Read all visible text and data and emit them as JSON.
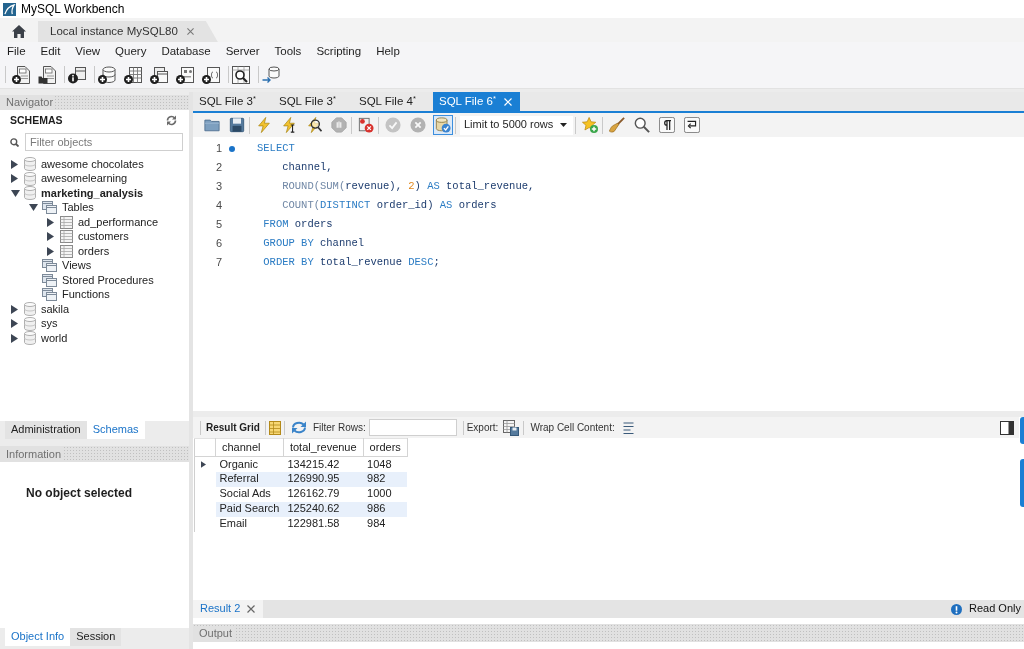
{
  "window": {
    "title": "MySQL Workbench"
  },
  "connection_tab": {
    "label": "Local instance MySQL80"
  },
  "menu": [
    "File",
    "Edit",
    "View",
    "Query",
    "Database",
    "Server",
    "Tools",
    "Scripting",
    "Help"
  ],
  "navigator": {
    "title": "Navigator",
    "section": "SCHEMAS",
    "filter": {
      "placeholder": "Filter objects"
    },
    "tree": [
      {
        "label": "awesome chocolates",
        "kind": "schema",
        "expanded": false,
        "active": false
      },
      {
        "label": "awesomelearning",
        "kind": "schema",
        "expanded": false,
        "active": false
      },
      {
        "label": "marketing_analysis",
        "kind": "schema",
        "expanded": true,
        "active": true,
        "children": [
          {
            "label": "Tables",
            "kind": "folder",
            "expanded": true,
            "children": [
              {
                "label": "ad_performance",
                "kind": "table",
                "expanded": false
              },
              {
                "label": "customers",
                "kind": "table",
                "expanded": false
              },
              {
                "label": "orders",
                "kind": "table",
                "expanded": false
              }
            ]
          },
          {
            "label": "Views",
            "kind": "folder"
          },
          {
            "label": "Stored Procedures",
            "kind": "folder"
          },
          {
            "label": "Functions",
            "kind": "folder"
          }
        ]
      },
      {
        "label": "sakila",
        "kind": "schema",
        "expanded": false,
        "active": false
      },
      {
        "label": "sys",
        "kind": "schema",
        "expanded": false,
        "active": false
      },
      {
        "label": "world",
        "kind": "schema",
        "expanded": false,
        "active": false
      }
    ],
    "tabs": [
      {
        "label": "Administration",
        "selected": false
      },
      {
        "label": "Schemas",
        "selected": true
      }
    ]
  },
  "information": {
    "title": "Information",
    "message": "No object selected",
    "tabs": [
      {
        "label": "Object Info",
        "selected": true
      },
      {
        "label": "Session",
        "selected": false
      }
    ]
  },
  "query_tabs": [
    {
      "label": "SQL File 3$^{*}$",
      "selected": false
    },
    {
      "label": "SQL File 3$^{*}$",
      "selected": false
    },
    {
      "label": "SQL File 4$^{*}$",
      "selected": false
    },
    {
      "label": "SQL File 6$^{*}$",
      "selected": true
    }
  ],
  "query_toolbar": {
    "buttons": [
      {
        "disabled": false,
        "on": false
      },
      {
        "disabled": false,
        "on": false
      },
      {
        "disabled": false,
        "on": false
      },
      {
        "disabled": false,
        "on": false
      },
      {
        "disabled": false,
        "on": false
      },
      {
        "disabled": true,
        "on": false
      },
      {
        "disabled": false,
        "on": false
      },
      {
        "disabled": true,
        "on": false
      },
      {
        "disabled": true,
        "on": false
      },
      {
        "disabled": false,
        "on": true
      },
      {
        "disabled": false,
        "on": false
      },
      {
        "disabled": false,
        "on": false
      },
      {
        "disabled": false,
        "on": false
      },
      {
        "disabled": false,
        "on": false
      },
      {
        "disabled": false,
        "on": false
      }
    ],
    "limit": "Limit to 5000 rows"
  },
  "editor": {
    "lines": [
      {
        "number": "1",
        "current": true,
        "tokens": [
          {
            "text": "SELECT",
            "kind": "keyword"
          }
        ]
      },
      {
        "number": "2",
        "current": false,
        "tokens": [
          {
            "text": "    channel,",
            "kind": "identifier"
          }
        ]
      },
      {
        "number": "3",
        "current": false,
        "tokens": [
          {
            "text": "    ROUND(SUM(",
            "kind": "function"
          },
          {
            "text": "revenue), ",
            "kind": "identifier"
          },
          {
            "text": "2",
            "kind": "number"
          },
          {
            "text": ") ",
            "kind": "identifier"
          },
          {
            "text": "AS",
            "kind": "keyword"
          },
          {
            "text": " total_revenue,",
            "kind": "identifier"
          }
        ]
      },
      {
        "number": "4",
        "current": false,
        "tokens": [
          {
            "text": "    COUNT(",
            "kind": "function"
          },
          {
            "text": "DISTINCT",
            "kind": "keyword"
          },
          {
            "text": " order_id) ",
            "kind": "identifier"
          },
          {
            "text": "AS",
            "kind": "keyword"
          },
          {
            "text": " orders",
            "kind": "identifier"
          }
        ]
      },
      {
        "number": "5",
        "current": false,
        "tokens": [
          {
            "text": " FROM",
            "kind": "keyword"
          },
          {
            "text": " orders",
            "kind": "identifier"
          }
        ]
      },
      {
        "number": "6",
        "current": false,
        "tokens": [
          {
            "text": " GROUP BY",
            "kind": "keyword"
          },
          {
            "text": " channel",
            "kind": "identifier"
          }
        ]
      },
      {
        "number": "7",
        "current": false,
        "tokens": [
          {
            "text": " ORDER BY",
            "kind": "keyword"
          },
          {
            "text": " total_revenue ",
            "kind": "identifier"
          },
          {
            "text": "DESC",
            "kind": "keyword"
          },
          {
            "text": ";",
            "kind": "identifier"
          }
        ]
      }
    ]
  },
  "result": {
    "toolbar": {
      "view_button": "Result Grid",
      "filter_label": "Filter Rows:",
      "export_label": "Export:",
      "wrap_label": "Wrap Cell Content:"
    },
    "columns": [
      "channel",
      "total_revenue",
      "orders"
    ],
    "rows": [
      {
        "current": true,
        "cells": [
          "Organic",
          "134215.42",
          "1048"
        ]
      },
      {
        "current": false,
        "cells": [
          "Referral",
          "126990.95",
          "982"
        ]
      },
      {
        "current": false,
        "cells": [
          "Social Ads",
          "126162.79",
          "1000"
        ]
      },
      {
        "current": false,
        "cells": [
          "Paid Search",
          "125240.62",
          "986"
        ]
      },
      {
        "current": false,
        "cells": [
          "Email",
          "122981.58",
          "984"
        ]
      }
    ],
    "tabs": [
      {
        "label": "Result 2",
        "selected": true
      }
    ],
    "status": "Read Only"
  },
  "output": {
    "title": "Output"
  }
}
